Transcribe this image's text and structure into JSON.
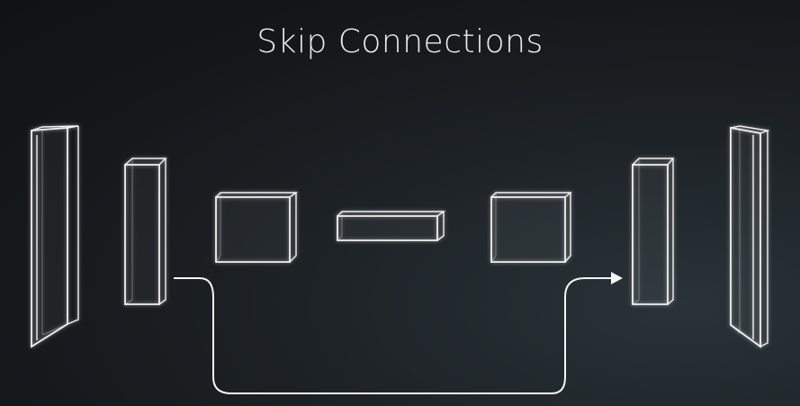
{
  "title": "Skip Connections",
  "colors": {
    "background": "#16191c",
    "lines": "#f2f2f2",
    "title": "#ececec"
  },
  "blocks": [
    {
      "name": "encoder-block-1",
      "role": "encoder"
    },
    {
      "name": "encoder-block-2",
      "role": "encoder"
    },
    {
      "name": "encoder-block-3",
      "role": "encoder"
    },
    {
      "name": "bottleneck-block",
      "role": "bottleneck"
    },
    {
      "name": "decoder-block-3",
      "role": "decoder"
    },
    {
      "name": "decoder-block-2",
      "role": "decoder"
    },
    {
      "name": "decoder-block-1",
      "role": "decoder"
    }
  ],
  "skip_connection": {
    "from": "encoder-block-2",
    "to": "decoder-block-2",
    "arrow": "right-arrow-icon"
  }
}
